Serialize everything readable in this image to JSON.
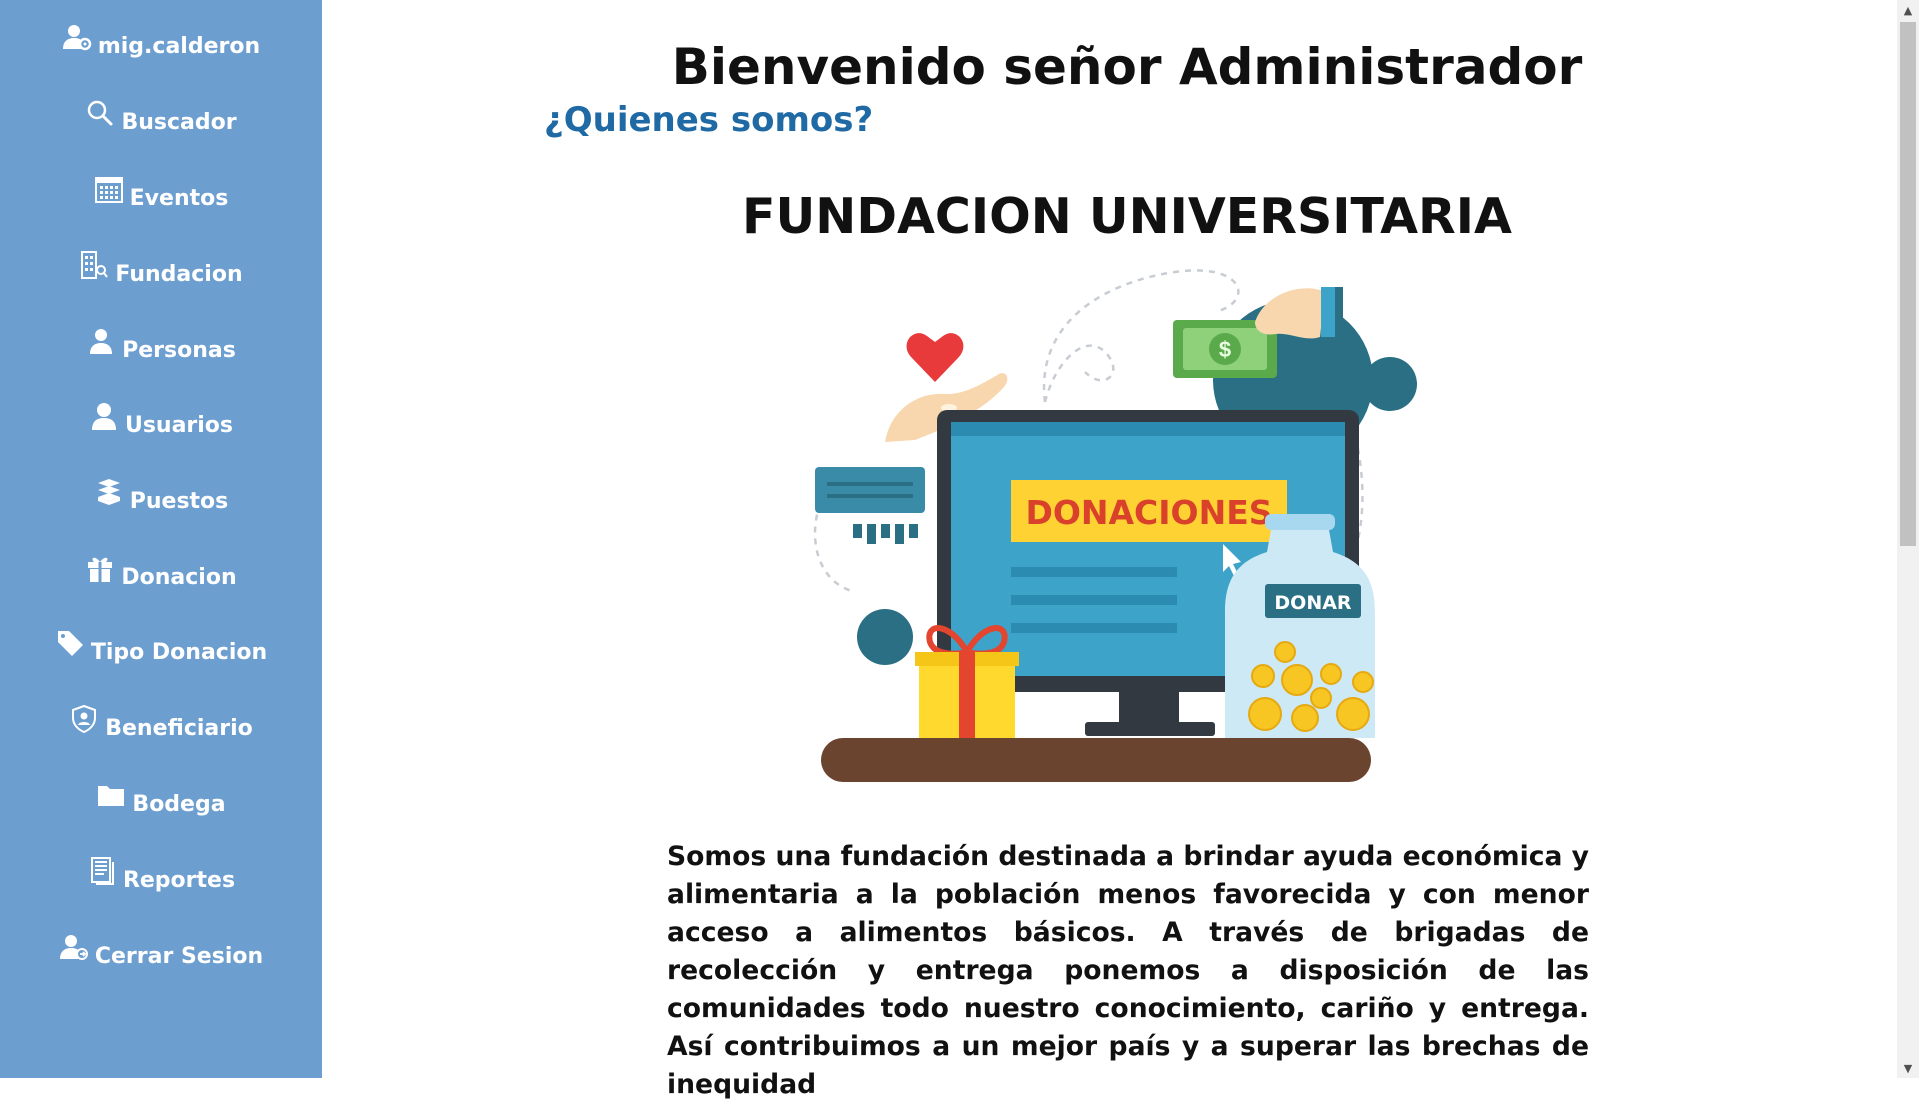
{
  "sidebar": {
    "items": [
      {
        "label": "mig.calderon",
        "icon": "user-settings-icon"
      },
      {
        "label": "Buscador",
        "icon": "search-icon"
      },
      {
        "label": "Eventos",
        "icon": "calendar-icon"
      },
      {
        "label": "Fundacion",
        "icon": "building-icon"
      },
      {
        "label": "Personas",
        "icon": "person-icon"
      },
      {
        "label": "Usuarios",
        "icon": "user-icon"
      },
      {
        "label": "Puestos",
        "icon": "boxes-icon"
      },
      {
        "label": "Donacion",
        "icon": "gift-icon"
      },
      {
        "label": "Tipo Donacion",
        "icon": "tag-icon"
      },
      {
        "label": "Beneficiario",
        "icon": "shield-user-icon"
      },
      {
        "label": "Bodega",
        "icon": "folder-icon"
      },
      {
        "label": "Reportes",
        "icon": "document-icon"
      },
      {
        "label": "Cerrar Sesion",
        "icon": "user-logout-icon"
      }
    ],
    "background": "#6d9ed0"
  },
  "main": {
    "title": "Bienvenido señor Administrador",
    "about_link": "¿Quienes somos?",
    "org_title": "FUNDACION UNIVERSITARIA",
    "illustration": {
      "banner_text": "DONACIONES",
      "jar_label": "DONAR"
    },
    "about_text": "Somos una fundación destinada a brindar ayuda económica y alimentaria a la población menos favorecida y con menor acceso a alimentos básicos. A través de brigadas de recolección y entrega ponemos a disposición de las comunidades todo nuestro conocimiento, cariño y entrega. Así contribuimos a un mejor país y a superar las brechas de inequidad"
  },
  "colors": {
    "link": "#1f6aa5",
    "banner_bg": "#ffd233",
    "banner_text": "#d9412b"
  }
}
